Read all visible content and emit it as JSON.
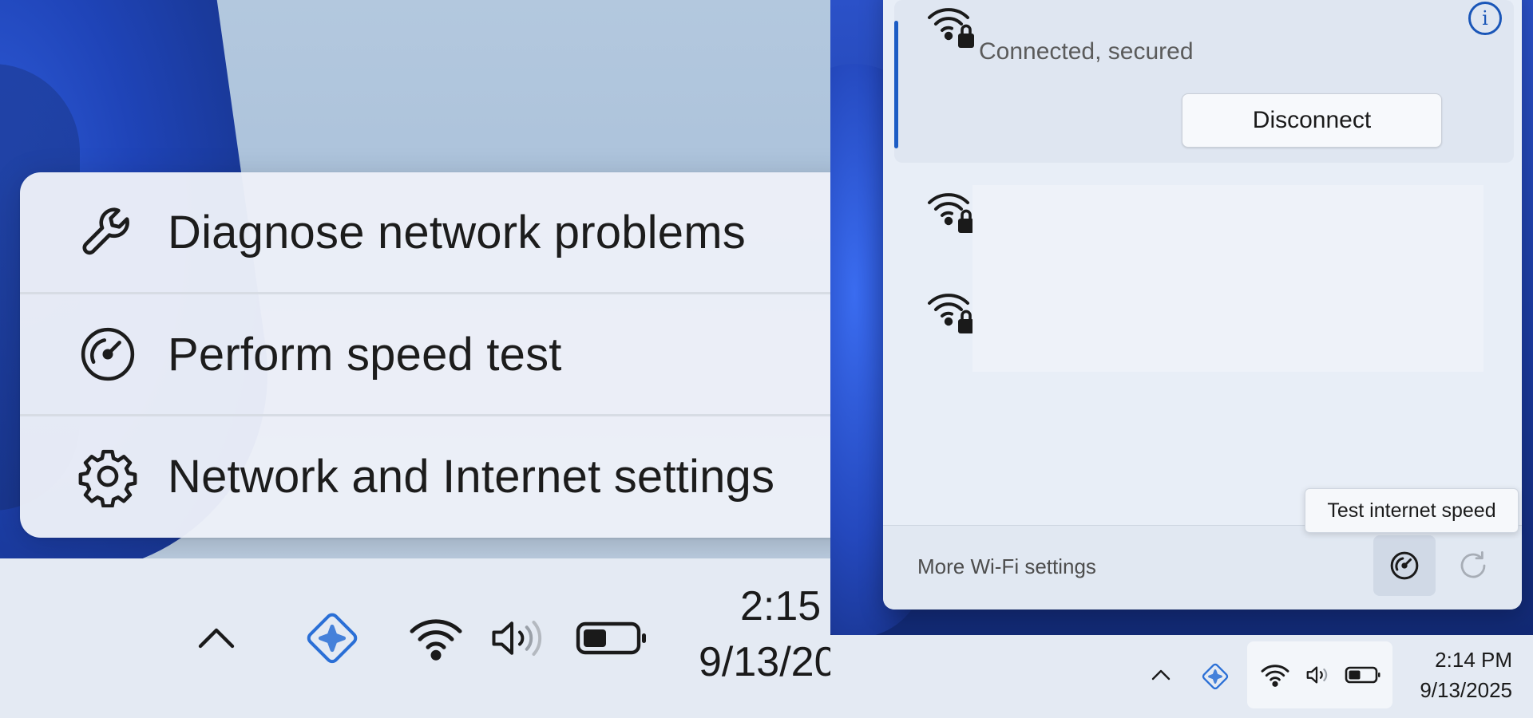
{
  "left": {
    "context_menu": {
      "items": [
        {
          "label": "Diagnose network problems",
          "icon": "wrench-icon"
        },
        {
          "label": "Perform speed test",
          "icon": "speedometer-icon"
        },
        {
          "label": "Network and Internet settings",
          "icon": "gear-icon"
        }
      ]
    },
    "taskbar": {
      "time": "2:15",
      "date": "9/13/20"
    }
  },
  "right": {
    "wifi_flyout": {
      "connected_network": {
        "status": "Connected, secured",
        "disconnect_label": "Disconnect",
        "info_symbol": "i"
      },
      "footer": {
        "more_settings_label": "More Wi-Fi settings"
      }
    },
    "tooltip": "Test internet speed",
    "taskbar": {
      "time": "2:14 PM",
      "date": "9/13/2025"
    }
  },
  "colors": {
    "accent": "#1c5cc4",
    "copilot": "#2a6fd6",
    "menu_bg": "#eceff8",
    "taskbar_bg": "#e4eaf3"
  }
}
